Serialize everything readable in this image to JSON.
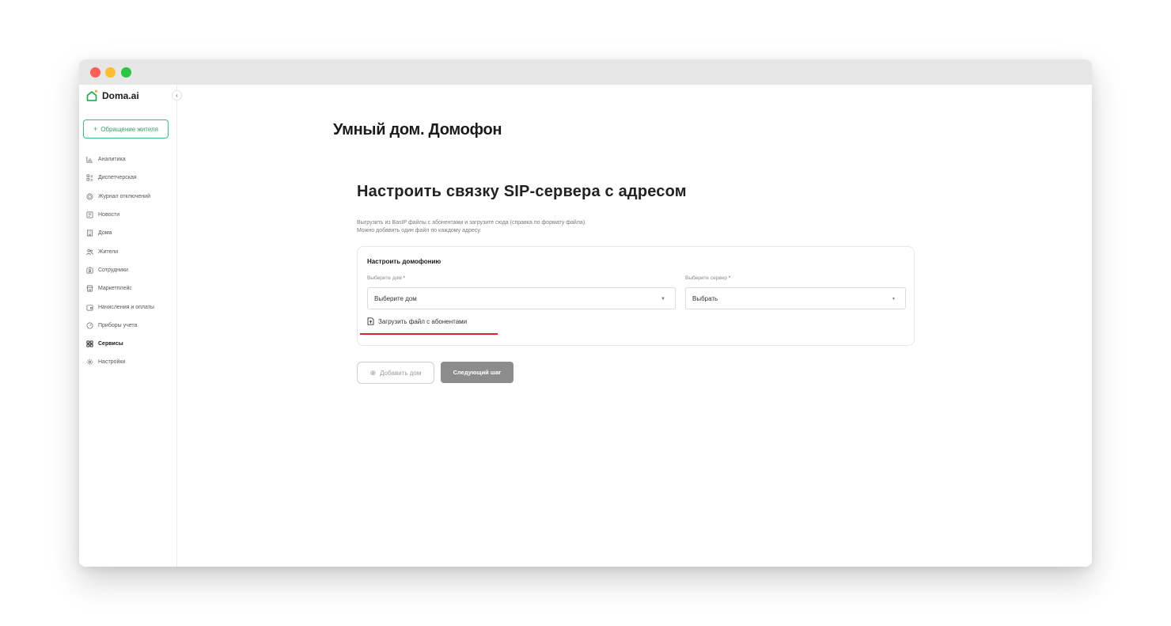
{
  "app": {
    "name": "Doma.ai"
  },
  "sidebar": {
    "appeal_button": {
      "icon": "plus-icon",
      "label": "Обращение жителя"
    },
    "items": [
      {
        "label": "Аналитика",
        "icon": "bar-chart-icon"
      },
      {
        "label": "Диспетчерская",
        "icon": "grid-list-icon"
      },
      {
        "label": "Журнал отключений",
        "icon": "target-icon"
      },
      {
        "label": "Новости",
        "icon": "newspaper-icon"
      },
      {
        "label": "Дома",
        "icon": "building-icon"
      },
      {
        "label": "Жители",
        "icon": "people-icon"
      },
      {
        "label": "Сотрудники",
        "icon": "badge-icon"
      },
      {
        "label": "Маркетплейс",
        "icon": "store-icon"
      },
      {
        "label": "Начисления и оплаты",
        "icon": "wallet-icon"
      },
      {
        "label": "Приборы учета",
        "icon": "meter-icon"
      },
      {
        "label": "Сервисы",
        "icon": "services-grid-icon",
        "active": true
      },
      {
        "label": "Настройки",
        "icon": "gear-icon"
      }
    ]
  },
  "main": {
    "page_title": "Умный дом. Домофон",
    "section_title": "Настроить связку SIP-сервера с адресом",
    "description": [
      "Выгрузить из BasIP файлы с абонентами и загрузите сюда (справка по формату файла).",
      "Можно добавить один файл по каждому адресу."
    ],
    "card": {
      "title": "Настроить домофонию",
      "house_field": {
        "label": "Выберите дом",
        "required_mark": "*",
        "value": "Выберите дом"
      },
      "server_field": {
        "label": "Выберите сервер",
        "required_mark": "*",
        "value": "Выбрать"
      },
      "upload_link": "Загрузить файл с абонентами"
    },
    "buttons": {
      "add_house": "Добавить дом",
      "next_step": "Следующий шаг"
    }
  },
  "help_button": "?",
  "colors": {
    "accent_green": "#3fbf74",
    "required_red": "#e23b3b",
    "highlight_underline": "#e0202a",
    "next_button_bg": "#8c8c8c"
  }
}
